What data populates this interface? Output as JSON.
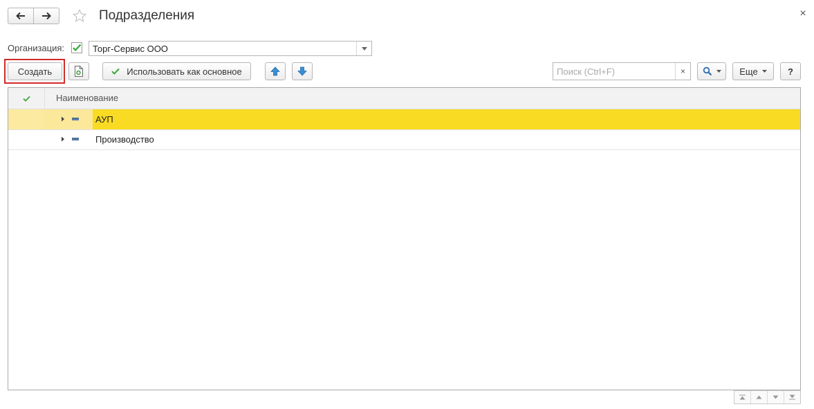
{
  "window": {
    "title": "Подразделения",
    "close_glyph": "×"
  },
  "organization": {
    "label": "Организация:",
    "value": "Торг-Сервис ООО",
    "checked": true
  },
  "toolbar": {
    "create_label": "Создать",
    "use_main_label": "Использовать как основное",
    "search_placeholder": "Поиск (Ctrl+F)",
    "search_clear_glyph": "×",
    "more_label": "Еще",
    "help_label": "?"
  },
  "table": {
    "columns": [
      "Наименование"
    ],
    "rows": [
      {
        "name": "АУП",
        "selected": true
      },
      {
        "name": "Производство",
        "selected": false
      }
    ]
  },
  "colors": {
    "selected_row": "#f9db24",
    "accent_green": "#3aa63a",
    "highlight_outline": "#d22a2a",
    "arrow_blue": "#3a8fd6"
  },
  "icons": [
    "back-arrow-icon",
    "forward-arrow-icon",
    "star-icon",
    "close-icon",
    "checkmark-icon",
    "chevron-down-icon",
    "copy-document-icon",
    "arrow-up-icon",
    "arrow-down-icon",
    "magnifier-icon",
    "tree-expand-icon",
    "group-icon"
  ]
}
